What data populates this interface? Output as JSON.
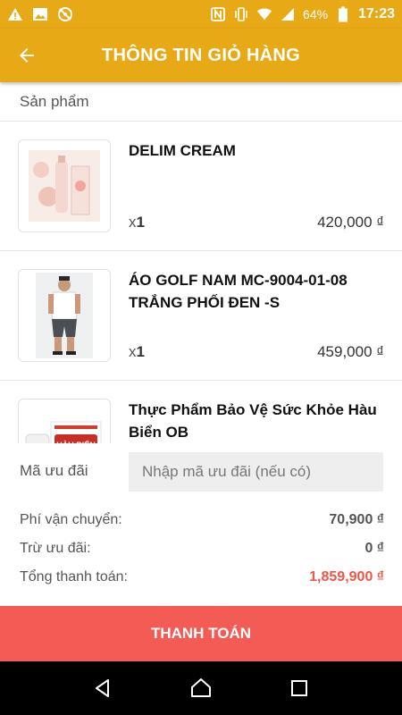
{
  "status_bar": {
    "battery_percent": "64%",
    "time": "17:23",
    "left_icons": [
      "warning-icon",
      "image-icon",
      "no-location-icon"
    ],
    "right_icons": [
      "nfc-icon",
      "vibrate-icon",
      "wifi-icon",
      "signal-icon",
      "battery-icon"
    ]
  },
  "header": {
    "title": "THÔNG TIN GIỎ HÀNG",
    "back_icon": "arrow-left-icon"
  },
  "cart": {
    "section_label": "Sản phẩm",
    "items": [
      {
        "name": "DELIM CREAM",
        "qty_prefix": "x",
        "qty": "1",
        "price": "420,000 ₫"
      },
      {
        "name": "ÁO GOLF NAM MC-9004-01-08 TRẮNG PHỐI ĐEN -S",
        "qty_prefix": "x",
        "qty": "1",
        "price": "459,000 ₫"
      },
      {
        "name": "Thực Phẩm Bảo Vệ Sức Khỏe Hàu Biển OB",
        "qty_prefix": "",
        "qty": "",
        "price": ""
      }
    ]
  },
  "summary": {
    "coupon_label": "Mã ưu đãi",
    "coupon_placeholder": "Nhập mã ưu đãi (nếu có)",
    "shipping_label": "Phí vận chuyển:",
    "shipping_value": "70,900 ₫",
    "discount_label": "Trừ ưu đãi:",
    "discount_value": "0 ₫",
    "total_label": "Tổng thanh toán:",
    "total_value": "1,859,900 ₫"
  },
  "checkout": {
    "label": "THANH TOÁN"
  },
  "colors": {
    "primary": "#e8a917",
    "checkout": "#f25c54",
    "total": "#f05545"
  }
}
